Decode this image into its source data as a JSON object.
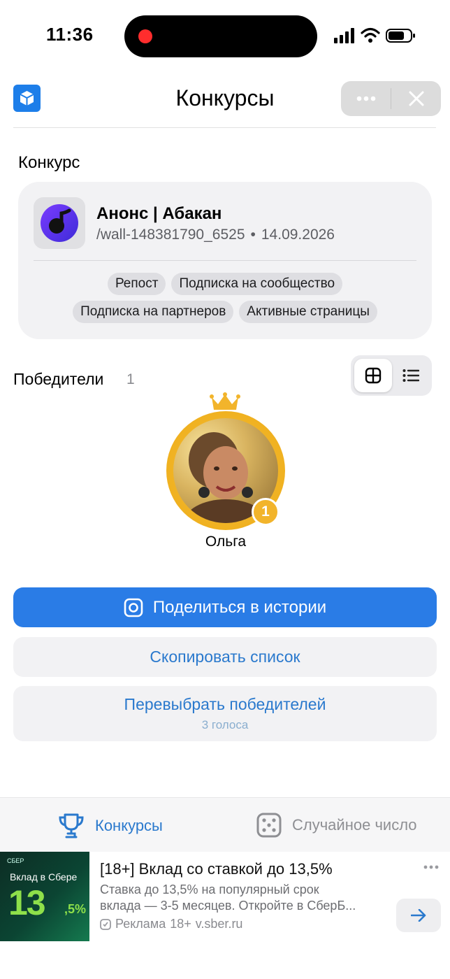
{
  "status_bar": {
    "time": "11:36"
  },
  "header": {
    "title": "Конкурсы"
  },
  "contest": {
    "section_label": "Конкурс",
    "name": "Анонс | Абакан",
    "wall": "/wall-148381790_6525",
    "separator": "•",
    "date": "14.09.2026",
    "conditions": [
      "Репост",
      "Подписка на сообщество",
      "Подписка на партнеров",
      "Активные страницы"
    ]
  },
  "winners": {
    "label": "Победители",
    "count": "1",
    "items": [
      {
        "name": "Ольга",
        "place": "1"
      }
    ]
  },
  "actions": {
    "share_story": "Поделиться в истории",
    "copy_list": "Скопировать список",
    "reselect": "Перевыбрать победителей",
    "reselect_sub": "3 голоса"
  },
  "tabs": [
    {
      "label": "Конкурсы",
      "icon": "trophy-icon",
      "active": true
    },
    {
      "label": "Случайное число",
      "icon": "dice-icon",
      "active": false
    }
  ],
  "ad": {
    "image_brand": "СБЕР",
    "image_headline": "Вклад в Сбере",
    "image_big": "13",
    "image_small": ",5%",
    "title": "[18+] Вклад со ставкой до 13,5%",
    "desc_line1": "Ставка до 13,5% на популярный срок",
    "desc_line2": "вклада — 3-5 месяцев. Откройте в СберБ...",
    "label": "Реклама",
    "age": "18+",
    "domain": "v.sber.ru"
  },
  "colors": {
    "accent": "#2a7ce6",
    "link": "#2a79cd",
    "gold": "#f0b120"
  }
}
